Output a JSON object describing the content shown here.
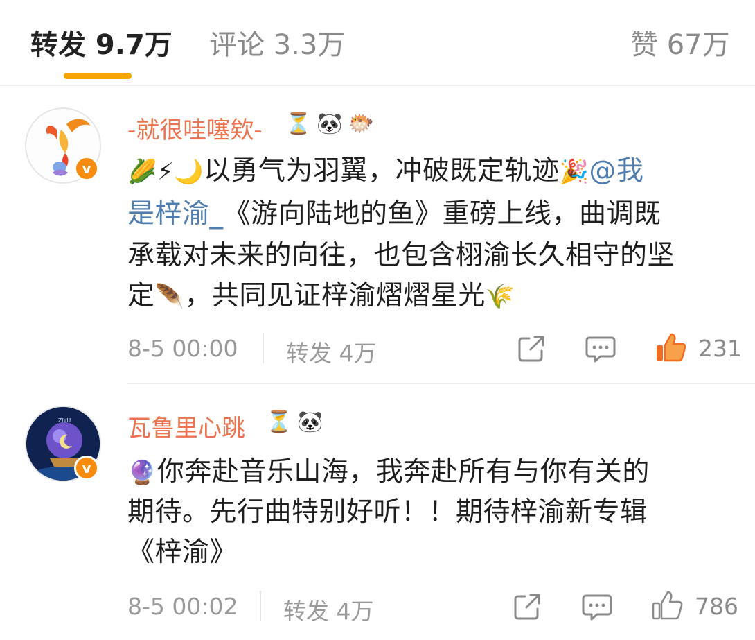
{
  "tabs": [
    {
      "label": "转发 9.7万",
      "active": true
    },
    {
      "label": "评论 3.3万",
      "active": false
    },
    {
      "label": "赞 67万",
      "active": false
    }
  ],
  "colors": {
    "accent": "#f7a400",
    "username": "#eb7350",
    "mention": "#507daf",
    "like_active": "#f26b1f"
  },
  "comments": [
    {
      "username": "-就很哇噻欸-",
      "badges": [
        "⏳",
        "🐼",
        "🐡"
      ],
      "verified": true,
      "lines": {
        "l1_emoji": "🌽⚡🌙",
        "l1_text": "以勇气为羽翼，冲破既定轨迹",
        "l1_emoji2": "🎉",
        "l1_mention": "@我",
        "l2_mention": "是梓渝_",
        "l2_text": "《游向陆地的鱼》重磅上线，曲调既",
        "l3_text": "承载对未来的向往，也包含栩渝长久相守的坚",
        "l4_text_a": "定",
        "l4_emoji": "🪶",
        "l4_text_b": "，共同见证梓渝熠熠星光",
        "l4_emoji2": "🌾"
      },
      "time": "8-5 00:00",
      "repost": "转发 4万",
      "likes": "231",
      "liked": true
    },
    {
      "username": "瓦鲁里心跳",
      "badges": [
        "⏳",
        "🐼"
      ],
      "verified": true,
      "lines": {
        "l1_emoji": "🔮",
        "l1_text": "你奔赴音乐山海，我奔赴所有与你有关的",
        "l2_text": "期待。先行曲特别好听！！期待梓渝新专辑",
        "l3_text": "《梓渝》"
      },
      "time": "8-5 00:02",
      "repost": "转发 4万",
      "likes": "786",
      "liked": false
    }
  ]
}
